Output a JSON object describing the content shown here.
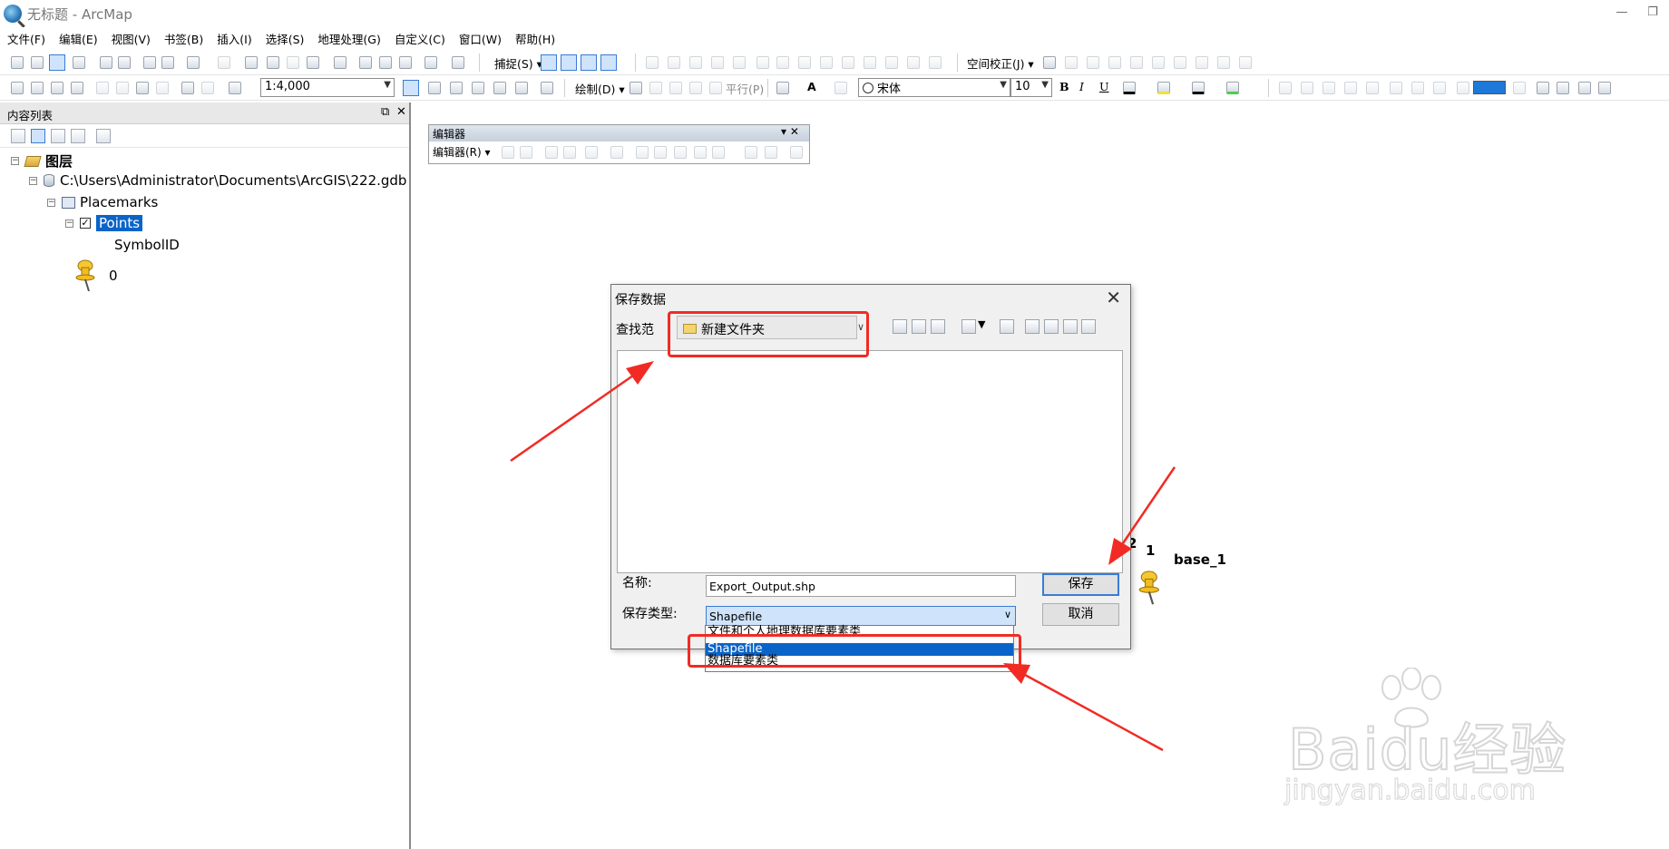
{
  "window": {
    "title": "无标题 - ArcMap",
    "restore_glyph": "❐",
    "minimize_glyph": "—"
  },
  "menu": [
    "文件(F)",
    "编辑(E)",
    "视图(V)",
    "书签(B)",
    "插入(I)",
    "选择(S)",
    "地理处理(G)",
    "自定义(C)",
    "窗口(W)",
    "帮助(H)"
  ],
  "toolbar1": {
    "snapping_label": "捕捉(S) ▾",
    "spatial_adjust_label": "空间校正(J) ▾"
  },
  "toolbar2": {
    "scale_value": "1:4,000",
    "draw_label": "绘制(D) ▾",
    "parallel_label": "平行(P)",
    "font_value": "宋体",
    "font_size_value": "10",
    "bold": "B",
    "italic": "I",
    "underline": "U",
    "text_tool": "A"
  },
  "toc": {
    "title": "内容列表",
    "pin_glyph": "⧉",
    "close_glyph": "✕",
    "tree": {
      "root": "图层",
      "gdb": "C:\\Users\\Administrator\\Documents\\ArcGIS\\222.gdb",
      "dataset": "Placemarks",
      "layer": "Points",
      "field": "SymbolID",
      "class_value": "0",
      "expander_collapse": "−",
      "check_mark": "✓"
    }
  },
  "editor_toolbar": {
    "title": "编辑器",
    "menu_label": "编辑器(R) ▾",
    "controls": "▾ ✕"
  },
  "dialog": {
    "title": "保存数据",
    "close_glyph": "✕",
    "lookin_label": "查找范",
    "lookin_value": "新建文件夹",
    "name_label": "名称:",
    "name_value": "Export_Output.shp",
    "type_label": "保存类型:",
    "type_value": "Shapefile",
    "save_button": "保存",
    "cancel_button": "取消",
    "type_options": [
      "文件和个人地理数据库要素类",
      "Shapefile",
      "数据库要素类"
    ],
    "selected_option_index": 1
  },
  "map": {
    "labels": [
      "2",
      "1",
      "base_1"
    ]
  },
  "watermark": {
    "text": "Baidu经验",
    "url": "jingyan.baidu.com"
  },
  "colors": {
    "annotation_red": "#f12b23",
    "selection_blue": "#0a64c8"
  }
}
